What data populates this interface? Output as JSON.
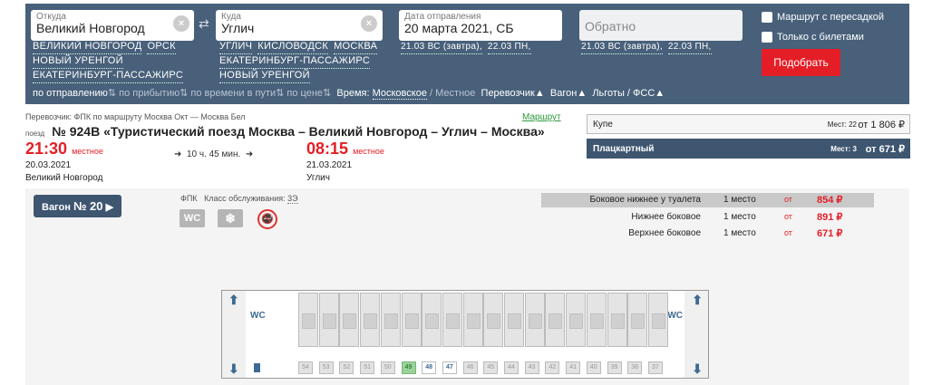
{
  "search": {
    "from": {
      "label": "Откуда",
      "value": "Великий Новгород",
      "suggestions": [
        "ВЕЛИКИЙ НОВГОРОД",
        "ОРСК",
        "НОВЫЙ УРЕНГОЙ",
        "ЕКАТЕРИНБУРГ-ПАССАЖИРС"
      ]
    },
    "to": {
      "label": "Куда",
      "value": "Углич",
      "suggestions": [
        "УГЛИЧ",
        "КИСЛОВОДСК",
        "МОСКВА",
        "ЕКАТЕРИНБУРГ-ПАССАЖИРС",
        "НОВЫЙ УРЕНГОЙ"
      ]
    },
    "depart": {
      "label": "Дата отправления",
      "value": "20 марта 2021, СБ",
      "quick": [
        "21.03 ВС (завтра),",
        "22.03 ПН,"
      ]
    },
    "return": {
      "placeholder": "Обратно",
      "quick": [
        "21.03 ВС (завтра),",
        "22.03 ПН,"
      ]
    },
    "opt_transfer": "Маршрут с пересадкой",
    "opt_tickets": "Только с билетами",
    "submit": "Подобрать",
    "clear": "×",
    "swap": "⇄"
  },
  "filters": {
    "by_depart": "по отправлению",
    "by_arrive": "по прибытию",
    "by_duration": "по времени в пути",
    "by_price": "по цене",
    "sort_icon": "⇅",
    "time_label": "Время:",
    "time_moscow": "Московское",
    "time_sep": "/",
    "time_local": "Местное",
    "carrier": "Перевозчик",
    "car": "Вагон",
    "benefits": "Льготы / ФСС",
    "caret": "▲"
  },
  "train": {
    "carrier_info": "Перевозчик: ФПК   по маршруту Москва Окт — Москва Бел",
    "route_link": "Маршрут",
    "prefix": "поезд",
    "title": "№ 924В «Туристический поезд Москва – Великий Новгород – Углич – Москва»",
    "dep_time": "21:30",
    "dep_note": "местное",
    "dep_date": "20.03.2021",
    "dep_station": "Великий Новгород",
    "duration": "10 ч. 45 мин.",
    "arr_time": "08:15",
    "arr_note": "местное",
    "arr_date": "21.03.2021",
    "arr_station": "Углич",
    "arrow": "➜"
  },
  "classes": [
    {
      "name": "Купе",
      "seats": "Мест: 22",
      "from": "от",
      "price": "1 806 ₽"
    },
    {
      "name": "Плацкартный",
      "seats": "Мест: 3",
      "from": "от",
      "price": "671 ₽"
    }
  ],
  "wagon": {
    "button": "Вагон",
    "number": "№ 20",
    "chevron": "▶",
    "carrier": "ФПК",
    "service_label": "Класс обслуживания:",
    "service_class": "3Э",
    "icons": [
      "wc-icon",
      "snowflake-icon",
      "no-smoking-icon"
    ],
    "icon_text": {
      "wc": "WC",
      "snow": "❄",
      "nosmoke": "🚭"
    },
    "seat_types": [
      {
        "name": "Боковое нижнее у туалета",
        "count": "1 место",
        "from": "от",
        "price": "854 ₽"
      },
      {
        "name": "Нижнее боковое",
        "count": "1 место",
        "from": "от",
        "price": "891 ₽"
      },
      {
        "name": "Верхнее боковое",
        "count": "1 место",
        "from": "от",
        "price": "671 ₽"
      }
    ],
    "map": {
      "wc": "WC",
      "up": "⬆",
      "down": "⬇",
      "side_numbers": [
        "54",
        "53",
        "52",
        "51",
        "50",
        "49",
        "48",
        "47",
        "46",
        "45",
        "44",
        "43",
        "42",
        "41",
        "40",
        "39",
        "38",
        "37"
      ],
      "free_seat": "49",
      "highlight_seats": [
        "47",
        "48"
      ]
    }
  },
  "colors": {
    "header": "#48607a",
    "accent": "#e41e26",
    "free": "#9ad39a"
  }
}
